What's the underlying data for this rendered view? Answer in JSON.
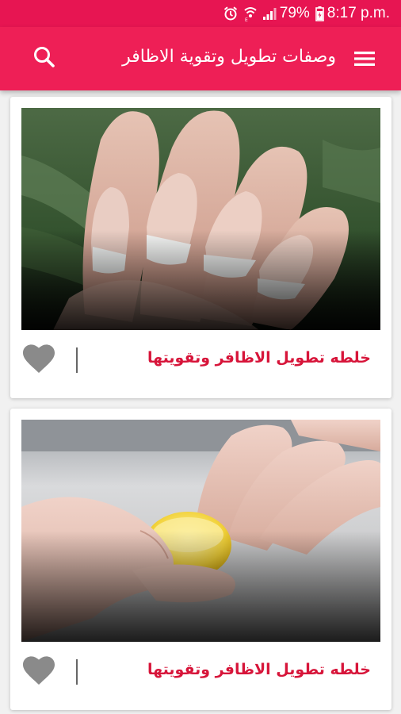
{
  "status_bar": {
    "battery": "79%",
    "time": "8:17 p.m.",
    "icons": [
      "alarm-icon",
      "wifi-icon",
      "signal-icon",
      "battery-icon"
    ]
  },
  "app_bar": {
    "title": "وصفات تطويل وتقوية الاظافر",
    "menu_icon": "hamburger-menu-icon",
    "search_icon": "search-icon"
  },
  "recipes": [
    {
      "title": "خلطه تطويل الاظافر وتقويتها",
      "favorite_icon": "heart-icon",
      "photo": "french-manicure-nails-photo"
    },
    {
      "title": "خلطه تطويل الاظافر وتقويتها",
      "favorite_icon": "heart-icon",
      "photo": "lemon-nails-photo"
    }
  ],
  "colors": {
    "status_bar": "#e71552",
    "app_bar": "#ee1f56",
    "title_text": "#d7153a",
    "heart": "#8a8a8a",
    "background": "#f1f1f1"
  }
}
